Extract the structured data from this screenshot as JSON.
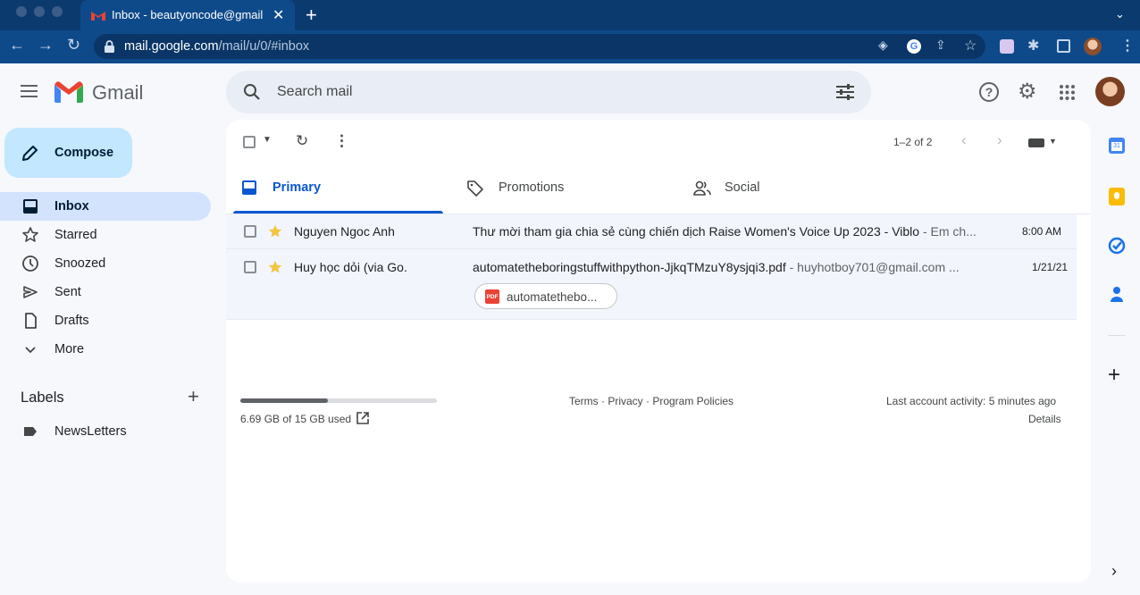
{
  "browser": {
    "tab_title": "Inbox - beautyoncode@gmail.c",
    "url_host": "mail.google.com",
    "url_path": "/mail/u/0/#inbox"
  },
  "header": {
    "app_name": "Gmail",
    "search_placeholder": "Search mail"
  },
  "sidebar": {
    "compose_label": "Compose",
    "items": [
      {
        "label": "Inbox",
        "icon": "inbox-icon",
        "active": true
      },
      {
        "label": "Starred",
        "icon": "star-icon"
      },
      {
        "label": "Snoozed",
        "icon": "clock-icon"
      },
      {
        "label": "Sent",
        "icon": "send-icon"
      },
      {
        "label": "Drafts",
        "icon": "draft-icon"
      },
      {
        "label": "More",
        "icon": "chevron-down-icon"
      }
    ],
    "labels_title": "Labels",
    "labels": [
      {
        "label": "NewsLetters"
      }
    ]
  },
  "toolbar": {
    "pagination": "1–2 of 2"
  },
  "tabs": [
    {
      "label": "Primary",
      "active": true
    },
    {
      "label": "Promotions"
    },
    {
      "label": "Social"
    }
  ],
  "emails": [
    {
      "sender": "Nguyen Ngoc Anh",
      "subject": "Thư mời tham gia chia sẻ cùng chiến dịch Raise Women's Voice Up 2023 - Viblo",
      "snippet": " - Em ch...",
      "time": "8:00 AM"
    },
    {
      "sender": "Huy học dỏi (via Go.",
      "subject": "automatetheboringstuffwithpython-JjkqTMzuY8ysjqi3.pdf",
      "snippet": " - huyhotboy701@gmail.com ...",
      "time": "1/21/21",
      "attachment": "automatethebo...",
      "attachment_type": "PDF"
    }
  ],
  "footer": {
    "storage_text": "6.69 GB of 15 GB used",
    "storage_fraction": 0.446,
    "links": "Terms · Privacy · Program Policies",
    "activity": "Last account activity: 5 minutes ago",
    "details": "Details"
  },
  "colors": {
    "accent": "#0b57d0",
    "active_nav": "#d3e3fd",
    "compose": "#c2e7ff",
    "star": "#f4c541"
  }
}
